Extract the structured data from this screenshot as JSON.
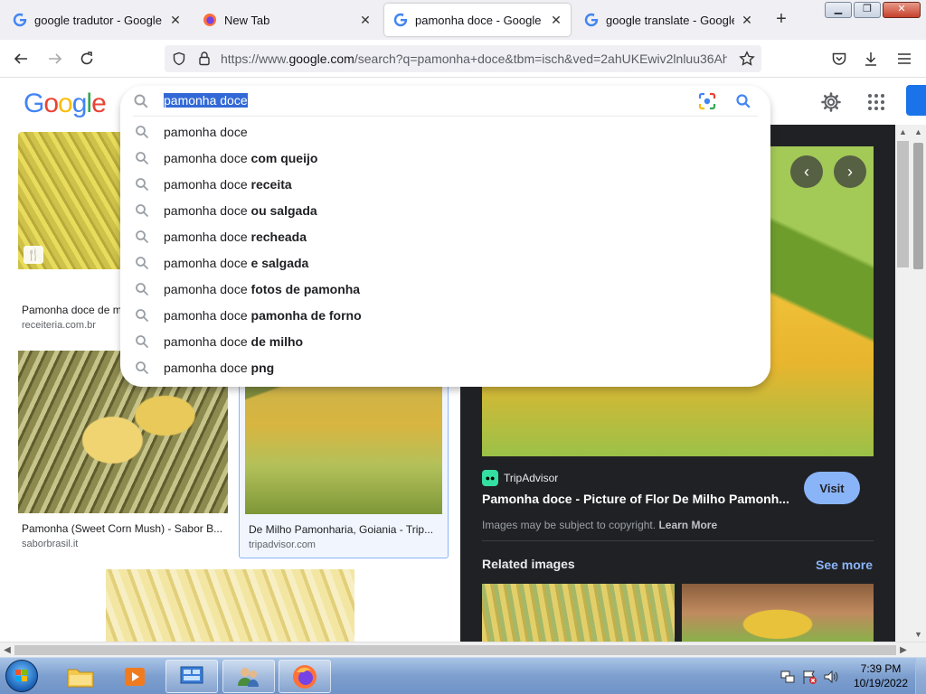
{
  "browser": {
    "tabs": [
      {
        "title": "google tradutor - Google Sea",
        "favicon": "google-g-icon",
        "active": false
      },
      {
        "title": "New Tab",
        "favicon": "firefox-icon",
        "active": false
      },
      {
        "title": "pamonha doce - Google Sear",
        "favicon": "google-g-icon",
        "active": true
      },
      {
        "title": "google translate - Google Sea",
        "favicon": "google-g-icon",
        "active": false
      }
    ],
    "new_tab_symbol": "+",
    "window_controls": {
      "minimize": "▁",
      "maximize": "❐",
      "close": "✕"
    },
    "url_prefix": "https://www.",
    "url_host": "google.com",
    "url_rest": "/search?q=pamonha+doce&tbm=isch&ved=2ahUKEwiv2lnluu36Ah"
  },
  "google": {
    "logo_letters": [
      "G",
      "o",
      "o",
      "g",
      "l",
      "e"
    ],
    "search_query": "pamonha doce",
    "suggestions": [
      {
        "base": "pamonha doce",
        "extra": ""
      },
      {
        "base": "pamonha doce ",
        "extra": "com queijo"
      },
      {
        "base": "pamonha doce ",
        "extra": "receita"
      },
      {
        "base": "pamonha doce ",
        "extra": "ou salgada"
      },
      {
        "base": "pamonha doce ",
        "extra": "recheada"
      },
      {
        "base": "pamonha doce ",
        "extra": "e salgada"
      },
      {
        "base": "pamonha doce ",
        "extra": "fotos de pamonha"
      },
      {
        "base": "pamonha doce ",
        "extra": "pamonha de forno"
      },
      {
        "base": "pamonha doce ",
        "extra": "de milho"
      },
      {
        "base": "pamonha doce ",
        "extra": "png"
      }
    ]
  },
  "results": [
    {
      "title": "Pamonha doce de m",
      "source": "receiteria.com.br",
      "recipe_badge": "🍴"
    },
    {
      "title": "Pamonha (Sweet Corn Mush) - Sabor B...",
      "source": "saborbrasil.it"
    },
    {
      "title": "De Milho Pamonharia, Goiania - Trip...",
      "source": "tripadvisor.com"
    }
  ],
  "preview": {
    "site_name": "TripAdvisor",
    "title": "Pamonha doce - Picture of Flor De Milho Pamonh...",
    "visit_label": "Visit",
    "copyright_text": "Images may be subject to copyright. ",
    "learn_more": "Learn More",
    "related_label": "Related images",
    "see_more": "See more",
    "prev_symbol": "‹",
    "next_symbol": "›"
  },
  "taskbar": {
    "time": "7:39 PM",
    "date": "10/19/2022"
  }
}
